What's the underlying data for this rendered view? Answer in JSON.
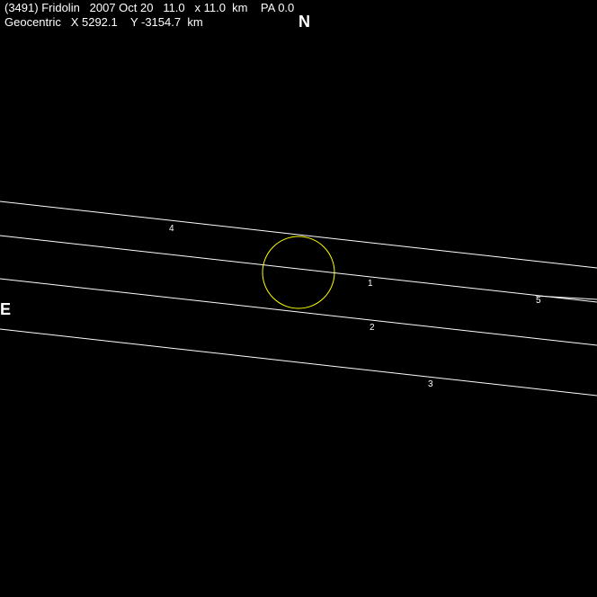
{
  "header": {
    "line1": "(3491) Fridolin   2007 Oct 20   11.0   x 11.0  km    PA 0.0",
    "line2": "Geocentric   X 5292.1    Y -3154.7  km"
  },
  "compass": {
    "north": "N",
    "east": "E"
  },
  "colors": {
    "background": "#000000",
    "text": "#ffffff",
    "chords": "#ffffff",
    "asteroid_outline": "#ffff00"
  },
  "chords": [
    {
      "label": "1"
    },
    {
      "label": "2"
    },
    {
      "label": "3"
    },
    {
      "label": "4"
    },
    {
      "label": "5"
    }
  ]
}
